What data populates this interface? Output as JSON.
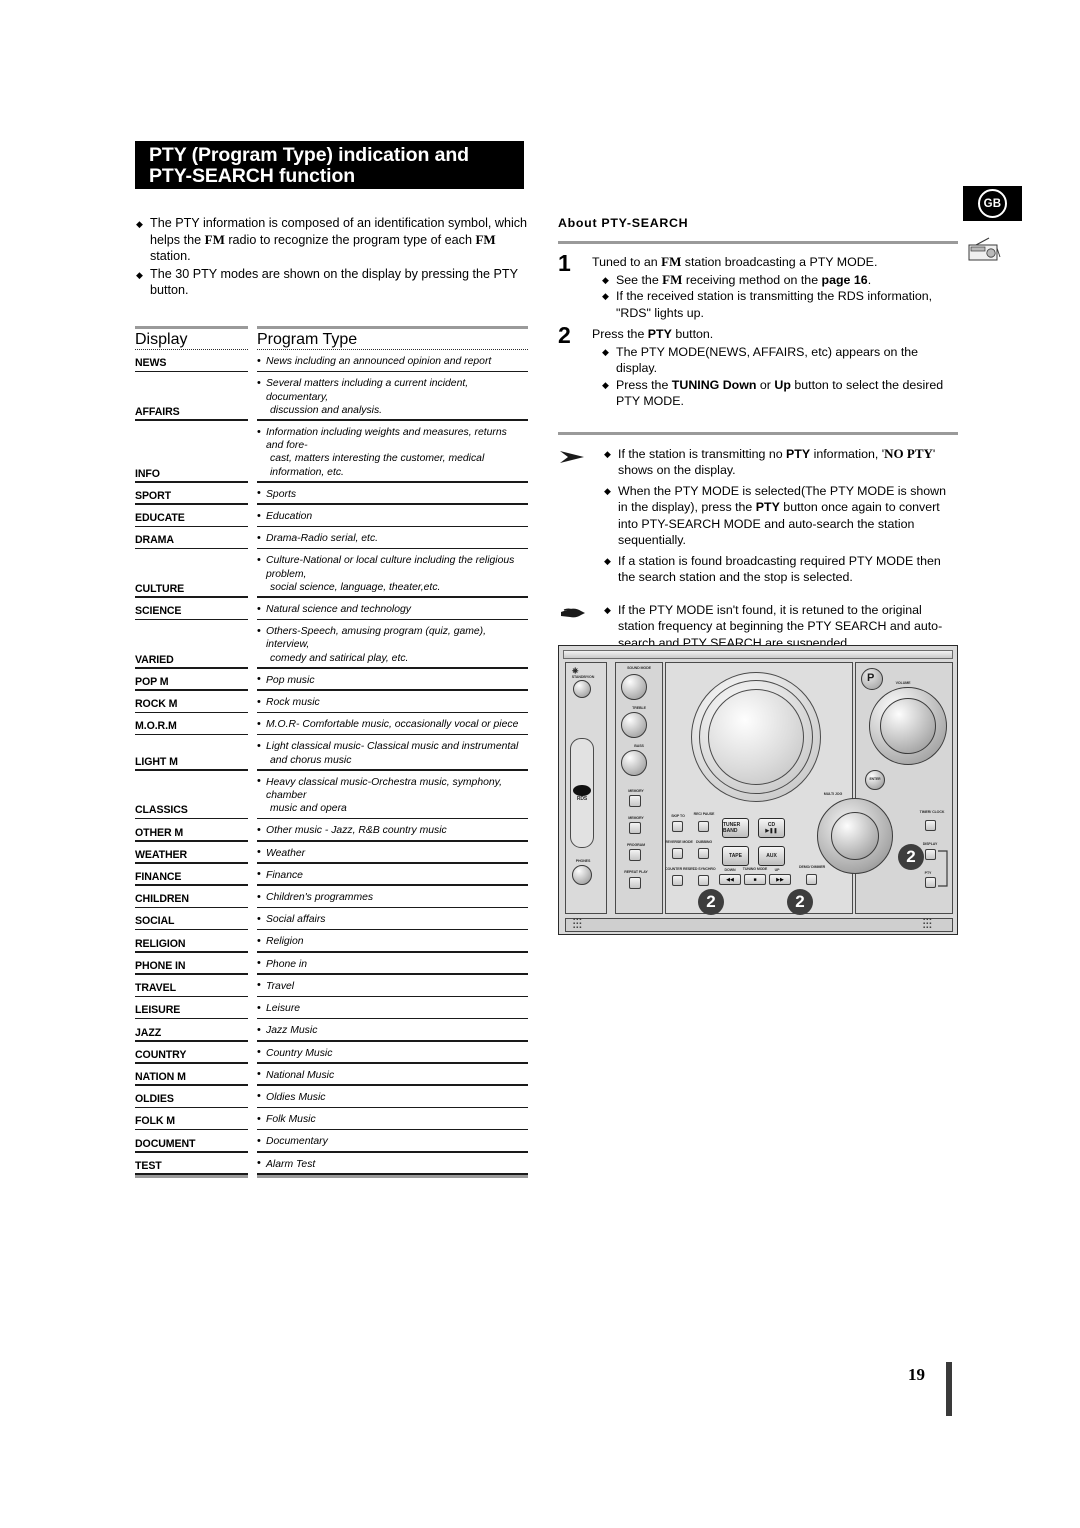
{
  "page": {
    "number": "19",
    "region_badge": "GB"
  },
  "title": {
    "line1": "PTY (Program Type) indication and",
    "line2": "PTY-SEARCH function"
  },
  "intro_bullets": [
    "The PTY information is composed of an identification symbol, which helps the FM radio to recognize the program type of each FM station.",
    "The 30 PTY modes are shown on the display by pressing the PTY button."
  ],
  "table": {
    "headers": {
      "display": "Display",
      "program_type": "Program Type"
    },
    "rows": [
      {
        "display": "NEWS",
        "type": "News including an announced opinion and report"
      },
      {
        "display": "AFFAIRS",
        "type": "Several matters including a current incident, documentary,",
        "type2": "discussion and analysis."
      },
      {
        "display": "INFO",
        "type": "Information including weights and measures, returns and fore-",
        "type2": "cast, matters interesting the customer, medical information, etc.",
        "wide": true
      },
      {
        "display": "SPORT",
        "type": "Sports"
      },
      {
        "display": "EDUCATE",
        "type": "Education"
      },
      {
        "display": "DRAMA",
        "type": "Drama-Radio serial, etc."
      },
      {
        "display": "CULTURE",
        "type": "Culture-National or local culture including the religious problem,",
        "type2": "social science, language, theater,etc."
      },
      {
        "display": "SCIENCE",
        "type": "Natural science and technology"
      },
      {
        "display": "VARIED",
        "type": "Others-Speech, amusing program (quiz, game), interview,",
        "type2": "comedy and satirical play, etc."
      },
      {
        "display": "POP M",
        "type": "Pop music"
      },
      {
        "display": "ROCK M",
        "type": "Rock music"
      },
      {
        "display": "M.O.R.M",
        "type": "M.O.R- Comfortable music, occasionally vocal or piece"
      },
      {
        "display": "LIGHT M",
        "type": "Light classical music- Classical music and instrumental",
        "type2": "and chorus music"
      },
      {
        "display": "CLASSICS",
        "type": "Heavy classical  music-Orchestra music, symphony, chamber",
        "type2": "music and opera"
      },
      {
        "display": "OTHER M",
        "type": "Other music - Jazz, R&B country music"
      },
      {
        "display": "WEATHER",
        "type": "Weather"
      },
      {
        "display": "FINANCE",
        "type": "Finance"
      },
      {
        "display": "CHILDREN",
        "type": "Children's programmes"
      },
      {
        "display": "SOCIAL",
        "type": "Social affairs"
      },
      {
        "display": "RELIGION",
        "type": "Religion"
      },
      {
        "display": "PHONE IN",
        "type": "Phone in"
      },
      {
        "display": "TRAVEL",
        "type": "Travel"
      },
      {
        "display": "LEISURE",
        "type": "Leisure"
      },
      {
        "display": "JAZZ",
        "type": "Jazz Music"
      },
      {
        "display": "COUNTRY",
        "type": "Country Music"
      },
      {
        "display": "NATION M",
        "type": "National Music"
      },
      {
        "display": "OLDIES",
        "type": "Oldies Music"
      },
      {
        "display": "FOLK M",
        "type": "Folk Music"
      },
      {
        "display": "DOCUMENT",
        "type": "Documentary"
      },
      {
        "display": "TEST",
        "type": "Alarm Test"
      }
    ]
  },
  "about": {
    "heading": "About PTY-SEARCH",
    "steps": [
      {
        "num": "1",
        "main_pre": "Tuned to an ",
        "main_bold": "FM",
        "main_post": " station broadcasting a PTY MODE.",
        "subs": [
          {
            "pre": "See the ",
            "bold": "FM",
            "mid": " receiving method on the ",
            "bold2": "page 16",
            "post": "."
          },
          {
            "pre": "If the received station is transmitting the RDS information, \"RDS\" lights up.",
            "bold": "",
            "mid": "",
            "bold2": "",
            "post": ""
          }
        ]
      },
      {
        "num": "2",
        "main_pre": "Press the ",
        "main_bold": "PTY",
        "main_post": " button.",
        "subs": [
          {
            "pre": "The PTY MODE(NEWS, AFFAIRS, etc) appears on the display.",
            "bold": "",
            "mid": "",
            "bold2": "",
            "post": ""
          },
          {
            "pre": "Press the ",
            "bold": "TUNING Down",
            "mid": " or ",
            "bold2": "Up",
            "post": " button to select the desired PTY MODE."
          }
        ]
      }
    ],
    "notes_arrow": [
      {
        "pre": "If the station is transmitting no ",
        "bold": "PTY",
        "mid": " information, '",
        "bold2": "NO PTY",
        "post": "' shows on the display."
      },
      {
        "pre": "When the PTY MODE is selected(The PTY MODE is shown in  the display), press the ",
        "bold": "PTY",
        "mid": " button once again to convert into PTY-SEARCH MODE and auto-search the station sequentially.",
        "bold2": "",
        "post": ""
      },
      {
        "pre": "If a station is found broadcasting required PTY MODE then the search station and the stop is selected.",
        "bold": "",
        "mid": "",
        "bold2": "",
        "post": ""
      }
    ],
    "notes_hand": [
      {
        "pre": "If the PTY MODE isn't found, it is retuned to the original station frequency at beginning the PTY SEARCH and auto-search and PTY SEARCH are suspended.",
        "bold": "",
        "mid": "",
        "bold2": "",
        "post": ""
      }
    ]
  },
  "device": {
    "callouts": [
      "2",
      "2",
      "2"
    ],
    "labels": {
      "standby": "STANDBY/ON",
      "sound_mode": "SOUND MODE",
      "treble": "TREBLE",
      "bass": "BASS",
      "rds": "RDS",
      "phones": "PHONES",
      "memory_t": "MEMORY",
      "memory": "MEMORY",
      "program": "PROGRAM",
      "repeat_play": "REPEAT PLAY",
      "skip_to": "SKIP TO",
      "reverse_mode": "REVERSE MODE",
      "counter_reset": "COUNTER RESET",
      "rec_pause": "REC/ PAUSE",
      "dubbing": "DUBBING",
      "cd_synchro": "CD SYNCHRO",
      "tuner_band": "TUNER BAND",
      "tape": "TAPE",
      "cd_play": "CD",
      "aux": "AUX",
      "down": "DOWN",
      "tuning_mode": "TUNING MODE",
      "up": "UP",
      "demo_dimmer": "DEMO/ DIMMER",
      "multi_jog": "MULTI JOG",
      "volume": "VOLUME",
      "enter": "ENTER",
      "timer_clock": "TIMER/ CLOCK",
      "display": "DISPLAY",
      "pty": "PTY",
      "rds_logo": "P"
    }
  }
}
